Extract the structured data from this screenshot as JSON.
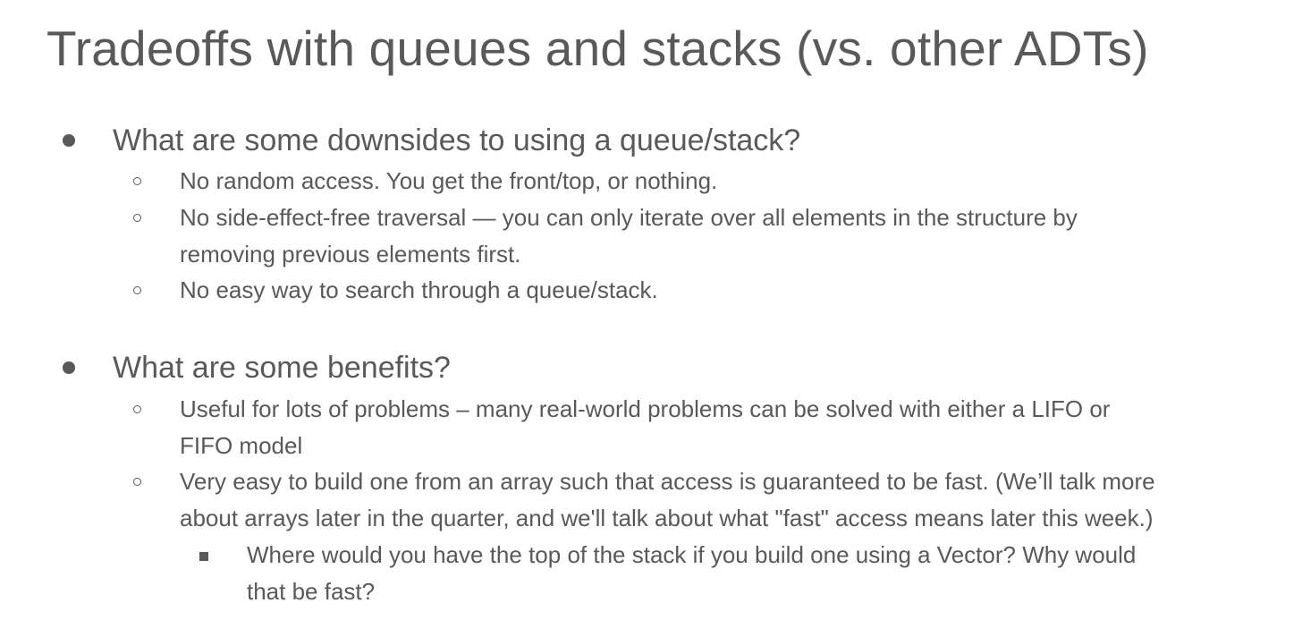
{
  "slide": {
    "title": "Tradeoffs with queues and stacks (vs. other ADTs)"
  },
  "sections": [
    {
      "heading": "What are some downsides to using a queue/stack?",
      "points": [
        {
          "lines": [
            "No random access. You get the front/top, or nothing."
          ]
        },
        {
          "lines": [
            "No side-effect-free traversal — you can only iterate over all elements in the structure by",
            "removing previous elements first."
          ]
        },
        {
          "lines": [
            "No easy way to search through a queue/stack."
          ]
        }
      ]
    },
    {
      "heading": "What are some benefits?",
      "points": [
        {
          "lines": [
            "Useful for lots of problems – many real-world problems can be solved with either a LIFO or",
            "FIFO model"
          ]
        },
        {
          "lines": [
            "Very easy to build one from an array such that access is guaranteed to be fast. (We’ll talk more",
            "about arrays later in the quarter, and we'll talk about what \"fast\" access means later this week.)"
          ],
          "subpoints": [
            {
              "lines": [
                "Where would you have the top of the stack if you build one using a Vector? Why would",
                "that be fast?"
              ]
            }
          ]
        }
      ]
    }
  ]
}
